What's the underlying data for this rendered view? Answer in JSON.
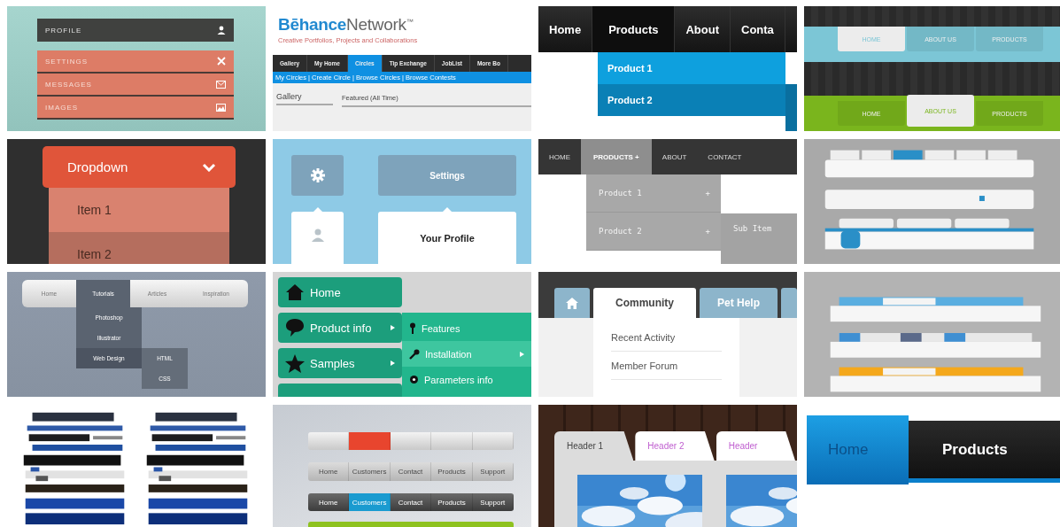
{
  "tiles": [
    {
      "kind": "flat-stack",
      "items": [
        {
          "label": "PROFILE",
          "selected": true
        },
        {
          "label": "SETTINGS",
          "selected": false
        },
        {
          "label": "MESSAGES",
          "selected": false
        },
        {
          "label": "IMAGES",
          "selected": false
        }
      ]
    },
    {
      "kind": "behance",
      "logo": "**Bēhance**Network$^{™}$",
      "tagline": "Creative Portfolios, Projects and Collaborations",
      "tabs": [
        {
          "label": "Gallery",
          "selected": false
        },
        {
          "label": "My Home",
          "selected": false
        },
        {
          "label": "Circles",
          "selected": true
        },
        {
          "label": "Tip Exchange",
          "selected": false
        },
        {
          "label": "JobList",
          "selected": false
        },
        {
          "label": "More Bo",
          "selected": false
        }
      ],
      "subnav": "My Circles | Create Circle | Browse Circles | Browse Contests",
      "section": "Gallery",
      "filter": "Featured (All Time)"
    },
    {
      "kind": "dark-dropdown",
      "tabs": [
        {
          "label": "Home",
          "selected": false
        },
        {
          "label": "Products",
          "selected": true
        },
        {
          "label": "About",
          "selected": false
        },
        {
          "label": "Conta",
          "selected": false
        }
      ],
      "items": [
        {
          "label": "Product 1",
          "selected": false
        },
        {
          "label": "Product 2",
          "selected": true
        }
      ]
    },
    {
      "kind": "twin-bars",
      "bars": [
        {
          "color": "#7cc6d6",
          "tabs": [
            {
              "label": "HOME",
              "selected": true
            },
            {
              "label": "ABOUT US",
              "selected": false
            },
            {
              "label": "PRODUCTS",
              "selected": false
            }
          ]
        },
        {
          "color": "#7ab51d",
          "tabs": [
            {
              "label": "HOME",
              "selected": false
            },
            {
              "label": "ABOUT US",
              "selected": true
            },
            {
              "label": "PRODUCTS",
              "selected": false
            }
          ]
        }
      ]
    },
    {
      "kind": "orange-dropdown",
      "button": "Dropdown",
      "items": [
        {
          "label": "Item 1",
          "selected": true
        },
        {
          "label": "Item 2",
          "selected": false
        }
      ]
    },
    {
      "kind": "icon-cards",
      "title": "Settings",
      "card": "Your Profile"
    },
    {
      "kind": "mono-dropdown",
      "tabs": [
        {
          "label": "HOME",
          "selected": false
        },
        {
          "label": "PRODUCTS",
          "marker": "+",
          "selected": true
        },
        {
          "label": "ABOUT",
          "selected": false
        },
        {
          "label": "CONTACT",
          "selected": false
        }
      ],
      "items": [
        {
          "label": "Product 1",
          "marker": "+"
        },
        {
          "label": "Product 2",
          "marker": "+"
        }
      ],
      "subitem": "Sub Item"
    },
    {
      "kind": "grey-bars-sheet"
    },
    {
      "kind": "pill-menu",
      "tabs": [
        {
          "label": "Home",
          "selected": false
        },
        {
          "label": "Tutorials",
          "selected": true
        },
        {
          "label": "Articles",
          "selected": false
        },
        {
          "label": "Inspiration",
          "selected": false
        }
      ],
      "items": [
        {
          "label": "Photoshop",
          "selected": false
        },
        {
          "label": "Illustrator",
          "selected": false
        },
        {
          "label": "Web Design",
          "selected": true
        }
      ],
      "subitems": [
        "HTML",
        "CSS"
      ]
    },
    {
      "kind": "green-menu",
      "items": [
        {
          "label": "Home",
          "submenu": false
        },
        {
          "label": "Product info",
          "submenu": true
        },
        {
          "label": "Samples",
          "submenu": true
        }
      ],
      "subitems": [
        {
          "label": "Features",
          "selected": false,
          "submenu": false
        },
        {
          "label": "Installation",
          "selected": true,
          "submenu": true
        },
        {
          "label": "Parameters info",
          "selected": false,
          "submenu": false
        }
      ]
    },
    {
      "kind": "folder-tabs",
      "tabs": [
        {
          "label": "Community",
          "selected": true
        },
        {
          "label": "Pet Help",
          "selected": false
        }
      ],
      "items": [
        "Recent Activity",
        "Member Forum"
      ]
    },
    {
      "kind": "ribbon-bars-sheet"
    },
    {
      "kind": "mini-bars-sheet"
    },
    {
      "kind": "glossy-bars",
      "bars": [
        {
          "kind": "light",
          "tabs": [
            {
              "selected": false
            },
            {
              "selected": true
            },
            {
              "selected": false
            },
            {
              "selected": false
            },
            {
              "selected": false
            }
          ]
        },
        {
          "kind": "silver",
          "tabs": [
            {
              "label": "Home",
              "selected": false
            },
            {
              "label": "Customers",
              "selected": false
            },
            {
              "label": "Contact",
              "selected": false
            },
            {
              "label": "Products",
              "selected": false
            },
            {
              "label": "Support",
              "selected": false
            }
          ]
        },
        {
          "kind": "dark",
          "tabs": [
            {
              "label": "Home",
              "selected": false
            },
            {
              "label": "Customers",
              "selected": true
            },
            {
              "label": "Contact",
              "selected": false
            },
            {
              "label": "Products",
              "selected": false
            },
            {
              "label": "Support",
              "selected": false
            }
          ]
        }
      ]
    },
    {
      "kind": "slanted-tabs",
      "tabs": [
        {
          "label": "Header 1",
          "selected": true
        },
        {
          "label": "Header 2",
          "selected": false
        },
        {
          "label": "Header",
          "selected": false
        }
      ]
    },
    {
      "kind": "block-tabs",
      "tabs": [
        {
          "label": "Home",
          "selected": true
        },
        {
          "label": "Products",
          "selected": false
        }
      ]
    }
  ]
}
